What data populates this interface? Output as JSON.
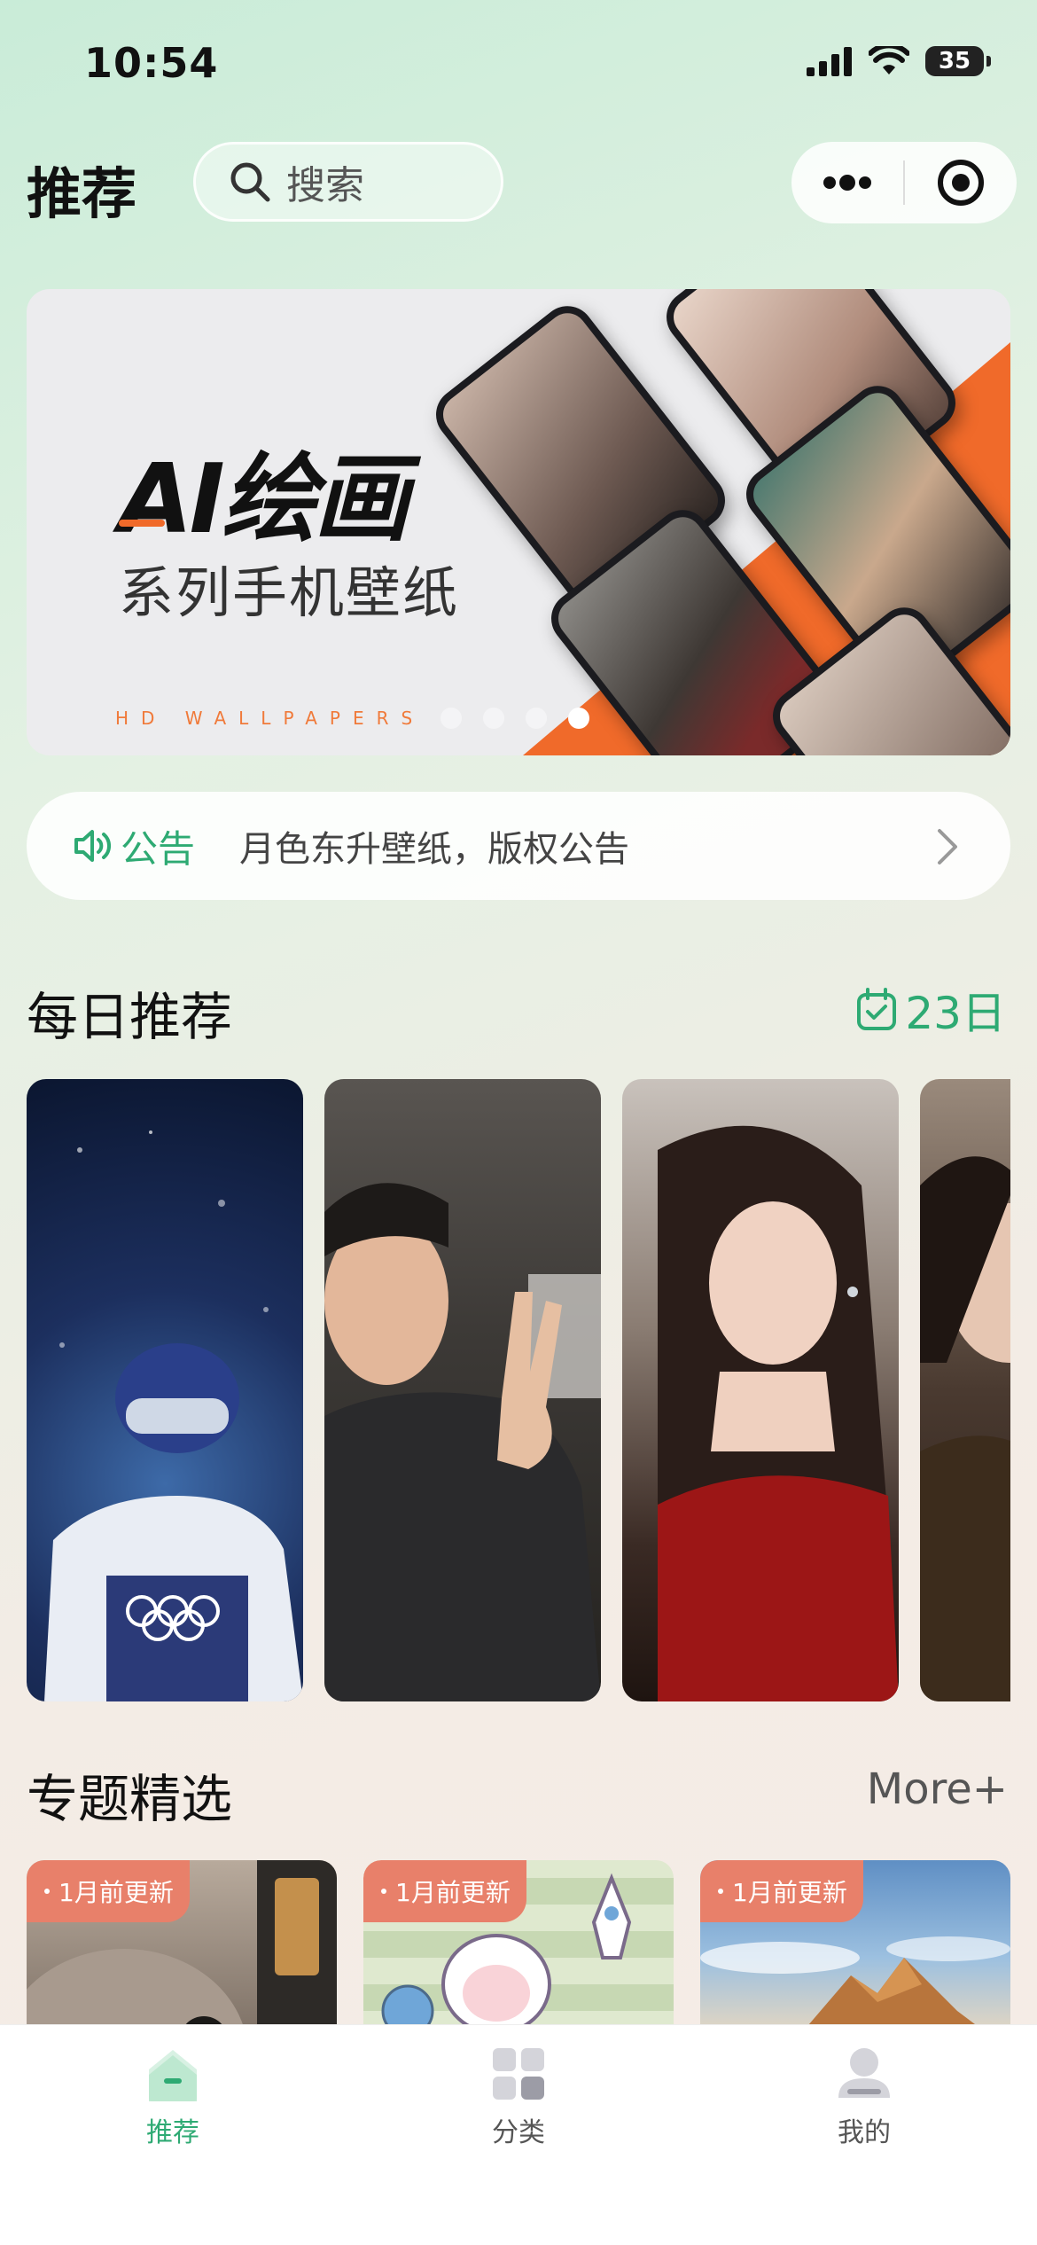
{
  "status_bar": {
    "time": "10:54",
    "battery": "35"
  },
  "header": {
    "title": "推荐",
    "search_placeholder": "搜索"
  },
  "banner": {
    "title": "AI绘画",
    "subtitle": "系列手机壁纸",
    "caption": "HD WALLPAPERS",
    "slide_count": 4,
    "active_slide": 4,
    "accent_color": "#f06a2a"
  },
  "notice": {
    "label": "公告",
    "text": "月色东升壁纸，版权公告"
  },
  "daily": {
    "title": "每日推荐",
    "date": "23日"
  },
  "topics": {
    "title": "专题精选",
    "more": "More+",
    "items": [
      {
        "badge": "1月前更新"
      },
      {
        "badge": "1月前更新"
      },
      {
        "badge": "1月前更新"
      }
    ]
  },
  "tabbar": {
    "items": [
      {
        "label": "推荐",
        "icon": "home-icon",
        "active": true
      },
      {
        "label": "分类",
        "icon": "category-icon",
        "active": false
      },
      {
        "label": "我的",
        "icon": "profile-icon",
        "active": false
      }
    ],
    "active_color": "#2eaa73"
  }
}
